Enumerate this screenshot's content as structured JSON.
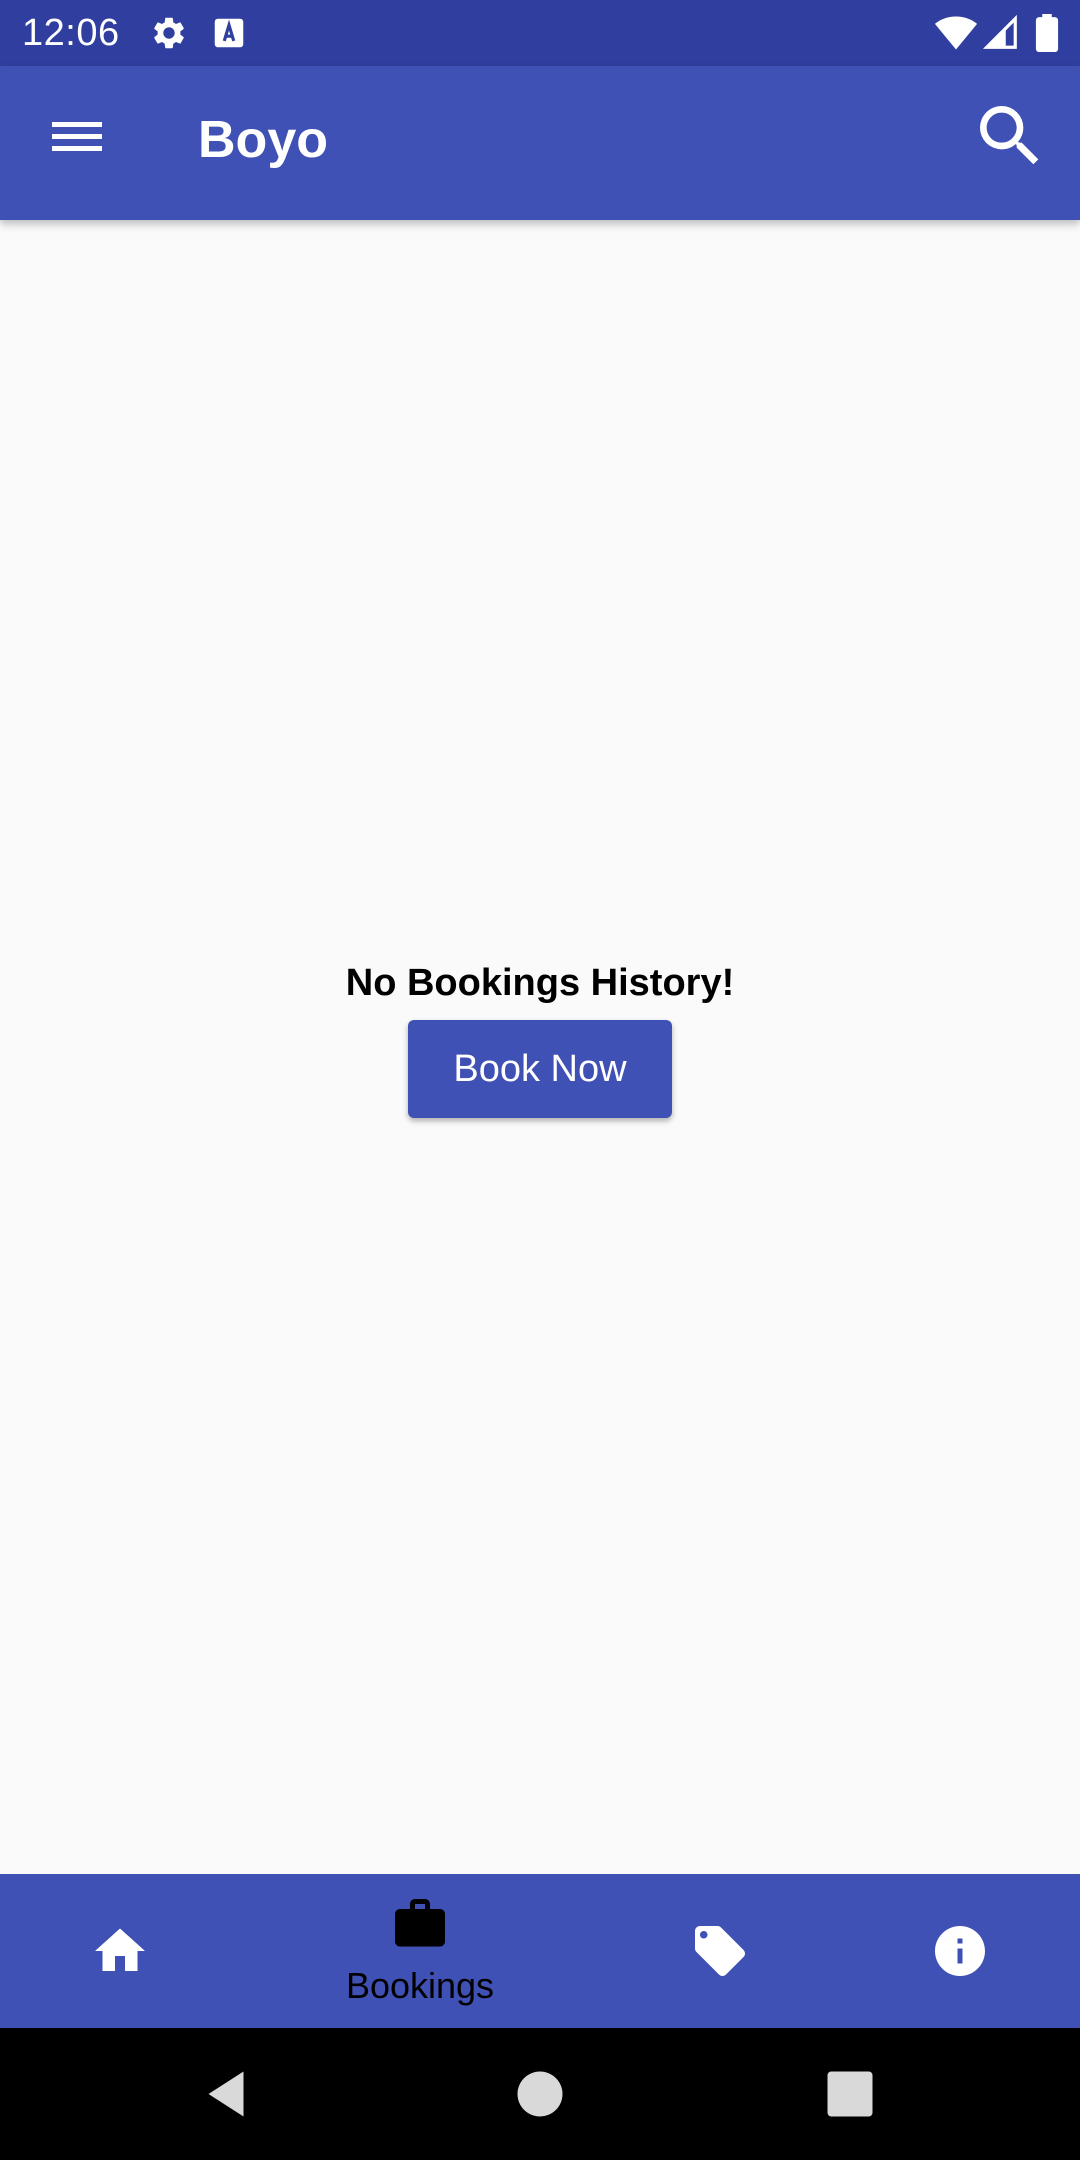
{
  "status_bar": {
    "time": "12:06",
    "icons": [
      "settings-icon",
      "keyboard-a-icon",
      "wifi-icon",
      "signal-icon",
      "battery-icon"
    ]
  },
  "app_bar": {
    "title": "Boyo",
    "menu_icon": "menu-icon",
    "search_icon": "search-icon"
  },
  "main": {
    "empty_message": "No Bookings History!",
    "book_now_label": "Book Now"
  },
  "bottom_nav": {
    "items": [
      {
        "icon": "home-icon",
        "label": "",
        "selected": false
      },
      {
        "icon": "briefcase-icon",
        "label": "Bookings",
        "selected": true
      },
      {
        "icon": "tag-icon",
        "label": "",
        "selected": false
      },
      {
        "icon": "info-icon",
        "label": "",
        "selected": false
      }
    ]
  },
  "system_nav": {
    "buttons": [
      "back-icon",
      "home-circle-icon",
      "recents-icon"
    ]
  },
  "colors": {
    "primary": "#3f51b5",
    "primary_dark": "#303f9f",
    "background": "#fafafa"
  }
}
